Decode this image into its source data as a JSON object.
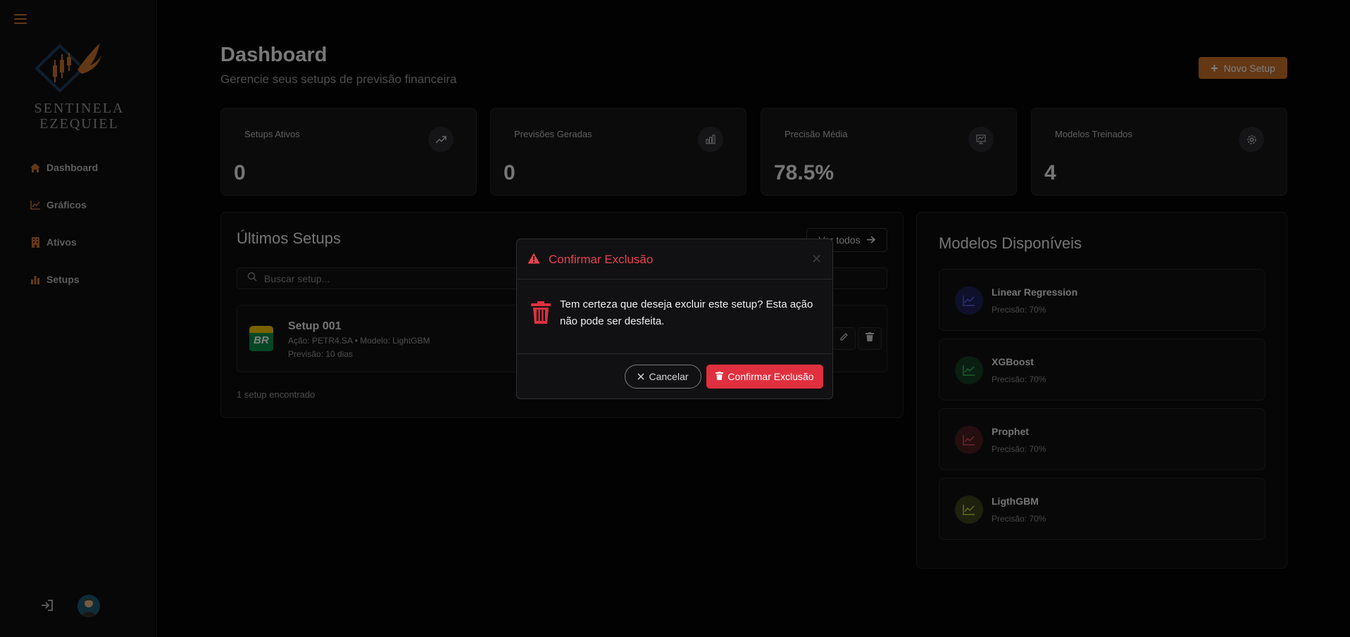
{
  "brand": {
    "name_line1": "SENTINELA",
    "name_line2": "EZEQUIEL"
  },
  "colors": {
    "accent": "#c8702a",
    "danger": "#e0303f",
    "background": "#040405"
  },
  "sidebar": {
    "items": [
      {
        "label": "Dashboard",
        "icon": "home-icon"
      },
      {
        "label": "Gráficos",
        "icon": "line-chart-icon"
      },
      {
        "label": "Ativos",
        "icon": "building-icon"
      },
      {
        "label": "Setups",
        "icon": "bar-chart-icon"
      }
    ]
  },
  "header": {
    "title": "Dashboard",
    "subtitle": "Gerencie seus setups de previsão financeira",
    "new_setup_label": "Novo Setup"
  },
  "stats": [
    {
      "label": "Setups Ativos",
      "value": "0",
      "icon": "trending-up-icon"
    },
    {
      "label": "Previsões Geradas",
      "value": "0",
      "icon": "bar-chart-icon"
    },
    {
      "label": "Precisão Média",
      "value": "78.5%",
      "icon": "presentation-chart-icon"
    },
    {
      "label": "Modelos Treinados",
      "value": "4",
      "icon": "gear-icon"
    }
  ],
  "latest_setups": {
    "title": "Últimos Setups",
    "see_all_label": "Ver todos",
    "search_placeholder": "Buscar setup...",
    "items": [
      {
        "name": "Setup 001",
        "meta_line1": "Ação: PETR4.SA • Modelo: LightGBM",
        "meta_line2": "Previsão: 10 dias",
        "logo_text": "BR"
      }
    ],
    "count_text": "1 setup encontrado"
  },
  "models": {
    "title": "Modelos Disponíveis",
    "items": [
      {
        "name": "Linear Regression",
        "precision": "Precisão: 70%",
        "color": "#3b3fd1"
      },
      {
        "name": "XGBoost",
        "precision": "Precisão: 70%",
        "color": "#22a04a"
      },
      {
        "name": "Prophet",
        "precision": "Precisão: 70%",
        "color": "#c9353f"
      },
      {
        "name": "LigthGBM",
        "precision": "Precisão: 70%",
        "color": "#a7b62c"
      }
    ]
  },
  "modal": {
    "title": "Confirmar Exclusão",
    "message": "Tem certeza que deseja excluir este setup? Esta ação não pode ser desfeita.",
    "cancel_label": "Cancelar",
    "confirm_label": "Confirmar Exclusão"
  }
}
